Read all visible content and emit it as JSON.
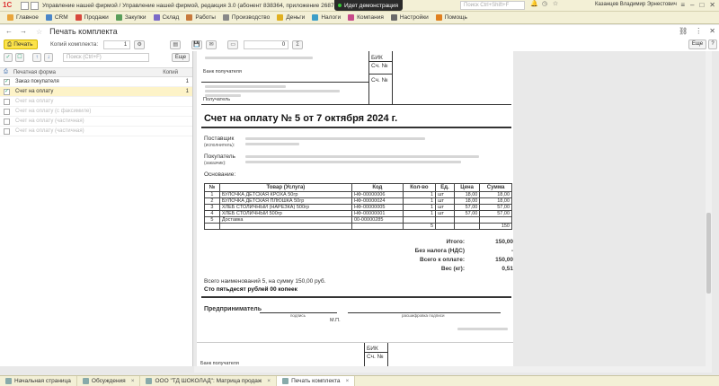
{
  "window": {
    "logo": "1С",
    "title": "Управление нашей фирмой / Управление нашей фирмой, редакция 3.0 (абонент 838364, приложение 2687865) (1С:Предприятие)",
    "demo_label": "Идет демонстрация",
    "search_placeholder": "Поиск Ctrl+Shift+F",
    "user": "Казанцев Владимир Эрнестович"
  },
  "menu": [
    {
      "label": "Главное",
      "color": "#e8a53c"
    },
    {
      "label": "CRM",
      "color": "#4a86c8"
    },
    {
      "label": "Продажи",
      "color": "#d8493d"
    },
    {
      "label": "Закупки",
      "color": "#5a9e5a"
    },
    {
      "label": "Склад",
      "color": "#7a6ac8"
    },
    {
      "label": "Работы",
      "color": "#c87a3c"
    },
    {
      "label": "Производство",
      "color": "#888888"
    },
    {
      "label": "Деньги",
      "color": "#e0b020"
    },
    {
      "label": "Налоги",
      "color": "#3c9ec8"
    },
    {
      "label": "Компания",
      "color": "#c84a8a"
    },
    {
      "label": "Настройки",
      "color": "#6a6a6a"
    },
    {
      "label": "Помощь",
      "color": "#e08020"
    }
  ],
  "header": {
    "title": "Печать комплекта"
  },
  "toolbar": {
    "print_label": "Печать",
    "copies_label": "Копий комплекта:",
    "copies_value": "1",
    "zoom_value": "0",
    "sigma": "Σ",
    "more_label": "Еще",
    "help_label": "?"
  },
  "left_panel": {
    "search_placeholder": "Поиск (Ctrl+F)",
    "more_label": "Еще",
    "col_form": "Печатная форма",
    "col_copies": "Копий",
    "rows": [
      {
        "label": "Заказ покупателя",
        "copies": "1",
        "checked": true,
        "selected": false,
        "dim": false
      },
      {
        "label": "Счет на оплату",
        "copies": "1",
        "checked": true,
        "selected": true,
        "dim": false
      },
      {
        "label": "Счет на оплату",
        "copies": "",
        "checked": false,
        "selected": false,
        "dim": true
      },
      {
        "label": "Счет на оплату (с факсимиле)",
        "copies": "",
        "checked": false,
        "selected": false,
        "dim": true
      },
      {
        "label": "Счет на оплату (частичная)",
        "copies": "",
        "checked": false,
        "selected": false,
        "dim": true
      },
      {
        "label": "Счет на оплату (частичная)",
        "copies": "",
        "checked": false,
        "selected": false,
        "dim": true
      }
    ]
  },
  "invoice": {
    "bik": "БИК",
    "sch": "Сч. №",
    "bank_recv": "Банк получателя",
    "recv": "Получатель",
    "title": "Счет на оплату № 5 от 7 октября 2024 г.",
    "supplier_label": "Поставщик",
    "supplier_sub": "(исполнитель):",
    "buyer_label": "Покупатель",
    "buyer_sub": "(заказчик):",
    "basis_label": "Основание:",
    "columns": [
      "№",
      "Товар (Услуга)",
      "Код",
      "Кол-во",
      "Ед.",
      "Цена",
      "Сумма"
    ],
    "rows": [
      {
        "n": "1",
        "name": "БУЛОЧКА ДЕТСКАЯ КРОХА 50гр",
        "code": "НФ-00000006",
        "qty": "1",
        "unit": "шт",
        "price": "18,00",
        "sum": "18,00"
      },
      {
        "n": "2",
        "name": "БУЛОЧКА ДЕТСКАЯ ПЛЮШКА 50гр",
        "code": "НФ-00000024",
        "qty": "1",
        "unit": "шт",
        "price": "18,00",
        "sum": "18,00"
      },
      {
        "n": "3",
        "name": "ХЛЕБ СТОЛИЧНЫЙ (НАРЕЗКА) 500гр",
        "code": "НФ-00000005",
        "qty": "1",
        "unit": "шт",
        "price": "57,00",
        "sum": "57,00"
      },
      {
        "n": "4",
        "name": "ХЛЕБ СТОЛИЧНЫЙ 500гр",
        "code": "НФ-00000001",
        "qty": "1",
        "unit": "шт",
        "price": "57,00",
        "sum": "57,00"
      },
      {
        "n": "5",
        "name": "Доставка",
        "code": "00-00000285",
        "qty": "",
        "unit": "",
        "price": "",
        "sum": ""
      }
    ],
    "qty_total": "5",
    "sum_total_row": "150",
    "totals": [
      {
        "label": "Итого:",
        "value": "150,00"
      },
      {
        "label": "Без налога (НДС)",
        "value": "-"
      },
      {
        "label": "Всего к оплате:",
        "value": "150,00"
      },
      {
        "label": "Вес (кг):",
        "value": "0,51"
      }
    ],
    "sum_text": "Всего наименований 5, на сумму 150,00 руб.",
    "sum_words": "Сто пятьдесят рублей 00 копеек",
    "entrepreneur": "Предприниматель",
    "sign_sub": "подпись",
    "decode_sub": "расшифровка подписи",
    "mp": "М.П."
  },
  "bottom_tabs": [
    {
      "label": "Начальная страница",
      "active": false
    },
    {
      "label": "Обсуждения",
      "active": false
    },
    {
      "label": "ООО \"ТД ШОКОЛАД\": Матрица продаж",
      "active": false
    },
    {
      "label": "Печать комплекта",
      "active": true
    }
  ]
}
